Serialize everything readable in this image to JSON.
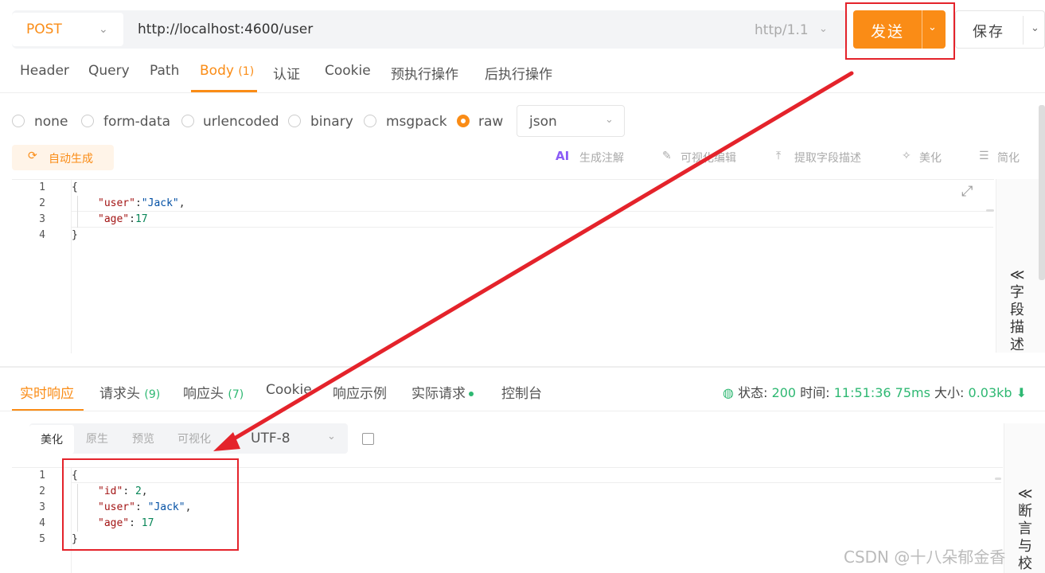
{
  "request": {
    "method": "POST",
    "url": "http://localhost:4600/user",
    "protocol": "http/1.1",
    "send_label": "发送",
    "save_label": "保存"
  },
  "request_tabs": {
    "header": "Header",
    "query": "Query",
    "path": "Path",
    "body": "Body",
    "body_count": "(1)",
    "auth": "认证",
    "cookie": "Cookie",
    "pre": "预执行操作",
    "post": "后执行操作"
  },
  "body_types": {
    "none": "none",
    "form_data": "form-data",
    "urlencoded": "urlencoded",
    "binary": "binary",
    "msgpack": "msgpack",
    "raw": "raw",
    "selected": "raw",
    "format": "json"
  },
  "toolbar": {
    "auto_generate": "自动生成",
    "ai_badge": "AI",
    "gen_comment": "生成注解",
    "visual_edit": "可视化编辑",
    "extract_desc": "提取字段描述",
    "beautify": "美化",
    "simplify": "简化"
  },
  "request_body": {
    "lines": [
      {
        "num": "1",
        "text": "{"
      },
      {
        "num": "2",
        "key": "\"user\"",
        "sep": ":",
        "val": "\"Jack\"",
        "trail": ","
      },
      {
        "num": "3",
        "key": "\"age\"",
        "sep": ":",
        "val": "17",
        "trail": ""
      },
      {
        "num": "4",
        "text": "}"
      }
    ]
  },
  "field_desc_panel": {
    "label": "≪ 字段描述"
  },
  "response_tabs": {
    "realtime": "实时响应",
    "req_headers": "请求头",
    "req_headers_count": "(9)",
    "res_headers": "响应头",
    "res_headers_count": "(7)",
    "cookie": "Cookie",
    "example": "响应示例",
    "actual": "实际请求",
    "console": "控制台"
  },
  "status": {
    "status_label": "状态:",
    "status_value": "200",
    "time_label": "时间:",
    "time_value": "11:51:36",
    "duration": "75ms",
    "size_label": "大小:",
    "size_value": "0.03kb"
  },
  "response_view": {
    "beautify": "美化",
    "raw": "原生",
    "preview": "预览",
    "visualize": "可视化",
    "encoding": "UTF-8"
  },
  "response_body": {
    "lines": [
      {
        "num": "1",
        "text": "{"
      },
      {
        "num": "2",
        "key": "\"id\"",
        "sep": ": ",
        "val": "2",
        "trail": ","
      },
      {
        "num": "3",
        "key": "\"user\"",
        "sep": ": ",
        "val": "\"Jack\"",
        "trail": ","
      },
      {
        "num": "4",
        "key": "\"age\"",
        "sep": ": ",
        "val": "17",
        "trail": ""
      },
      {
        "num": "5",
        "text": "}"
      }
    ]
  },
  "assert_panel": {
    "label": "≪ 断言与校"
  },
  "watermark": "CSDN @十八朵郁金香",
  "colors": {
    "accent": "#fa8c16",
    "success": "#2eb872",
    "annotation": "#e4232b"
  }
}
